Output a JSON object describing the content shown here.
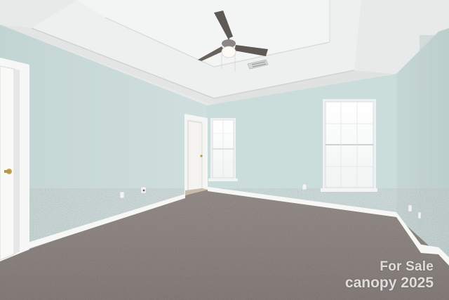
{
  "photo": {
    "subject": "empty-bedroom",
    "colors": {
      "wall": "#c9dcda",
      "ceiling": "#eceeed",
      "carpet": "#807774",
      "trim": "#f7f7f5"
    }
  },
  "watermark": {
    "line1": "For Sale",
    "brand": "canopy",
    "year": "2025"
  }
}
